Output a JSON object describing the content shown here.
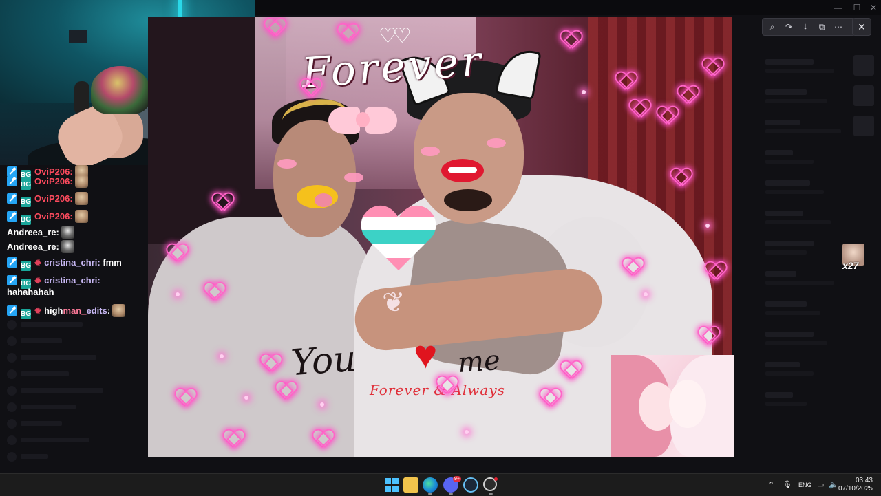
{
  "colors": {
    "accent": "#4cc2ff",
    "chat_red": "#ff4b5e",
    "heart_pink": "#ff66c8",
    "taskbar_bg": "#1c1c1c"
  },
  "chat": {
    "rows": [
      {
        "user": "OviP206:",
        "badges": [
          "hammer-badge",
          "bg-badge"
        ],
        "color": "red",
        "message": "",
        "emote": "emote"
      },
      {
        "user": "OviP206:",
        "badges": [
          "hammer-badge",
          "bg-badge"
        ],
        "color": "red",
        "message": "",
        "emote": "emote"
      },
      {
        "user": "OviP206:",
        "badges": [
          "hammer-badge",
          "bg-badge"
        ],
        "color": "red",
        "message": "",
        "emote": "emote"
      },
      {
        "user": "Andreea_re:",
        "badges": [],
        "color": "white",
        "message": "",
        "emote": "emote"
      },
      {
        "user": "Andreea_re:",
        "badges": [],
        "color": "white",
        "message": "",
        "emote": "emote"
      },
      {
        "user": "cristina_chri:",
        "badges": [
          "hammer-badge",
          "bg-badge",
          "star-badge"
        ],
        "color": "lavender",
        "message": "fmm"
      },
      {
        "user": "cristina_chri:",
        "badges": [
          "hammer-badge",
          "bg-badge",
          "star-badge"
        ],
        "color": "lavender",
        "message": "hahahahah"
      },
      {
        "user_parts": [
          "high",
          "man_",
          "edits"
        ],
        "user_suffix": ":",
        "badges": [
          "hammer-badge",
          "bg-badge",
          "star-badge"
        ],
        "message": "",
        "emote": "emote"
      }
    ],
    "bg_badge_text": "BG"
  },
  "photo": {
    "title_text": "Forever",
    "you_text": "You",
    "me_text": "me",
    "heart_glyph": "♥",
    "subtitle": "Forever & Always",
    "butterfly_glyph": "❦"
  },
  "side_badge": {
    "count": "x27"
  },
  "viewer_toolbar": {
    "icons": [
      "zoom-icon",
      "rotate-icon",
      "download-icon",
      "open-external-icon",
      "more-icon"
    ],
    "glyphs": [
      "⌕",
      "↷",
      "⤓",
      "⧉",
      "⋯"
    ],
    "close_glyph": "✕"
  },
  "window_controls": {
    "minimize": "—",
    "maximize": "☐",
    "close": "✕"
  },
  "taskbar": {
    "discord_badge": "9+",
    "tray": {
      "chevron": "⌃",
      "mic": "🎙",
      "language": "ENG",
      "network": "▭",
      "volume": "🔈"
    },
    "clock": {
      "time": "03:43",
      "date": "07/10/2025"
    }
  }
}
